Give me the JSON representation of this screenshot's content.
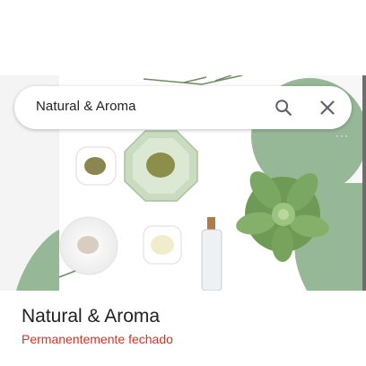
{
  "search": {
    "query": "Natural & Aroma"
  },
  "place": {
    "name": "Natural & Aroma",
    "status": "Permanentemente fechado"
  },
  "photo": {
    "more_indicator": "···"
  },
  "colors": {
    "accent_green": "#96b896",
    "status_red": "#d93025",
    "text_primary": "#202124"
  },
  "icons": {
    "search": "search-icon",
    "close": "close-icon"
  }
}
